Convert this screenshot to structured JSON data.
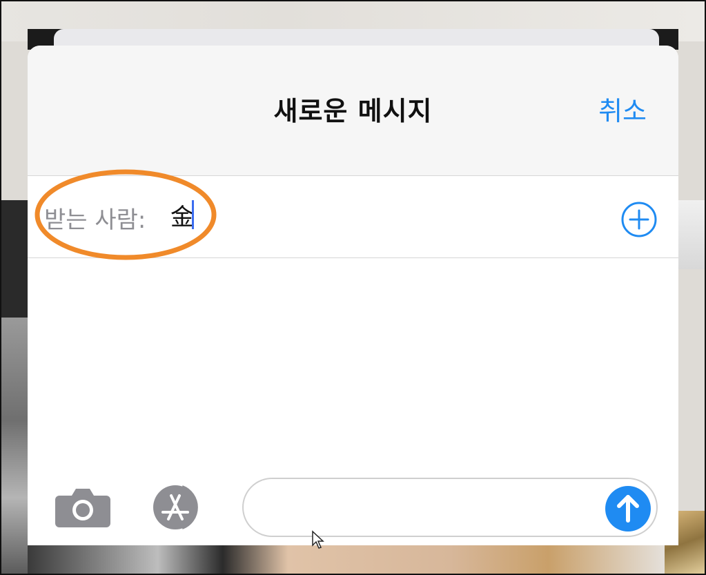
{
  "header": {
    "title": "새로운 메시지",
    "cancel_label": "취소"
  },
  "recipient": {
    "label": "받는 사람:",
    "value": "金"
  },
  "icons": {
    "add": "plus-circle-icon",
    "camera": "camera-icon",
    "appstore": "app-store-icon",
    "send": "arrow-up-icon"
  },
  "colors": {
    "accent": "#1f8bf2",
    "highlight_ring": "#f08a2a",
    "icon_gray": "#8e8e93"
  }
}
